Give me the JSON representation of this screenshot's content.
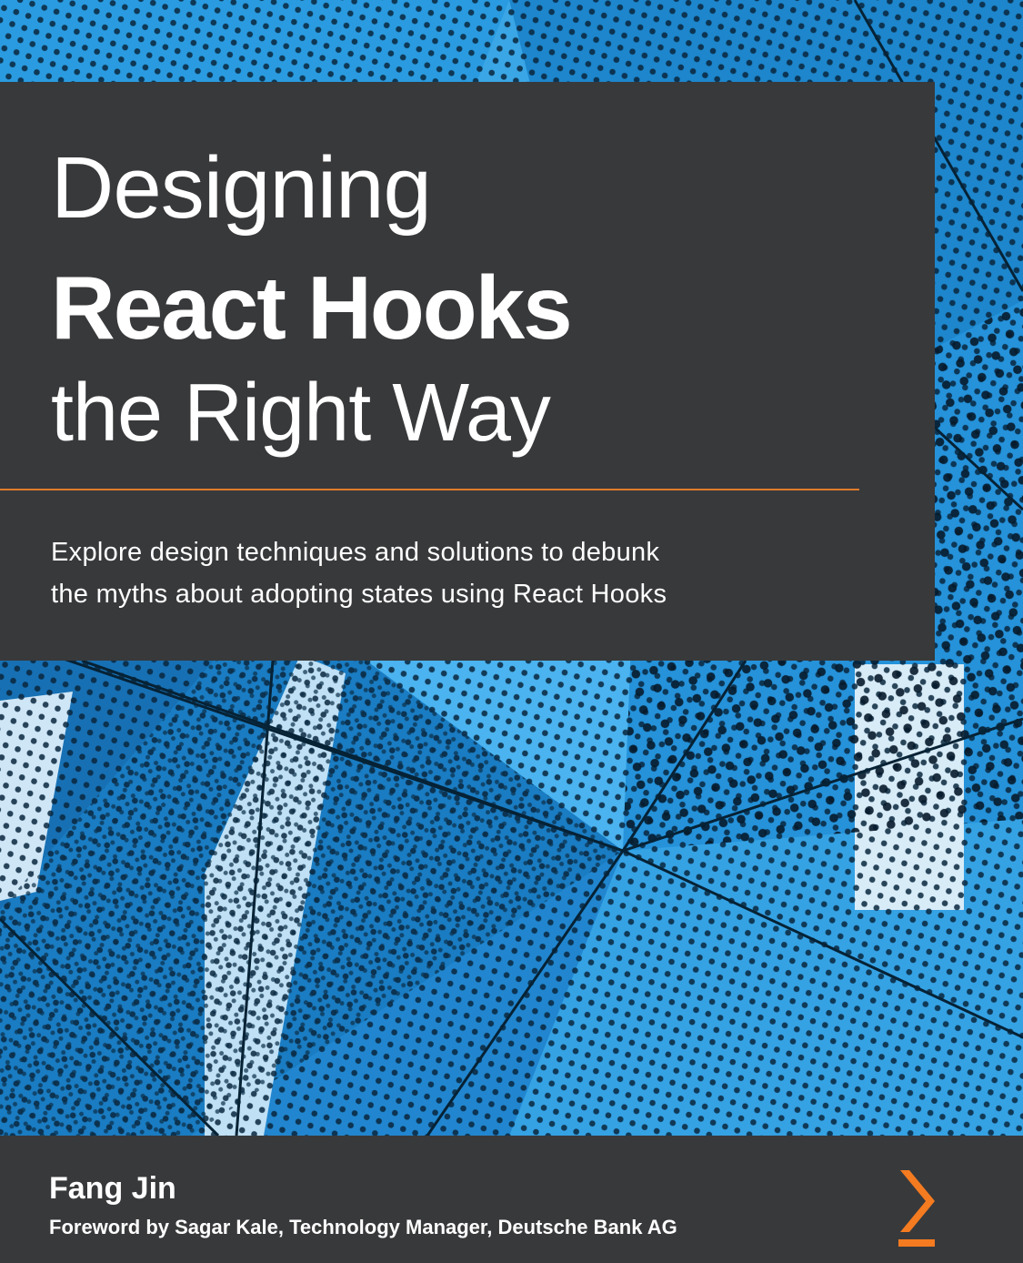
{
  "book": {
    "title_line_1": "Designing",
    "title_line_2": "React Hooks",
    "title_line_3": "the Right Way",
    "subtitle_line_1": "Explore design techniques and solutions to debunk",
    "subtitle_line_2": "the myths about adopting states using React Hooks",
    "author": "Fang Jin",
    "foreword": "Foreword by Sagar Kale, Technology Manager, Deutsche Bank AG"
  },
  "colors": {
    "panel": "#38393b",
    "accent": "#e07b2c",
    "panel_blue": "#1f8fd6",
    "text": "#ffffff"
  },
  "icons": {
    "publisher_logo": "packt-chevron-logo-icon"
  }
}
